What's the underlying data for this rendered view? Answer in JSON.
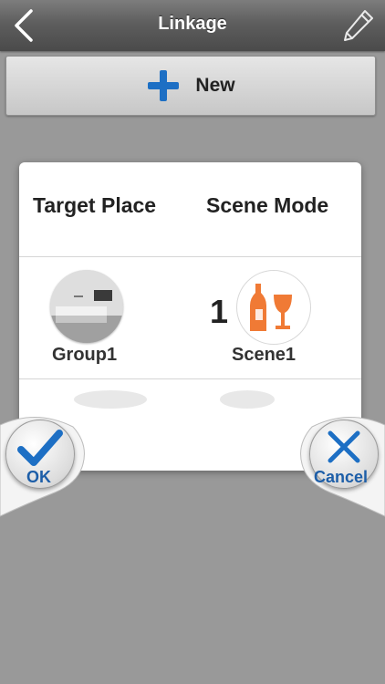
{
  "header": {
    "title": "Linkage"
  },
  "toolbar": {
    "new_label": "New"
  },
  "dialog": {
    "columns": [
      "Target Place",
      "Scene Mode"
    ],
    "rows": [
      {
        "place": "Group1",
        "scene_number": "1",
        "scene": "Scene1"
      }
    ]
  },
  "actions": {
    "ok_label": "OK",
    "cancel_label": "Cancel"
  },
  "colors": {
    "accent_blue": "#1d6fc4",
    "scene_orange": "#f07a35"
  }
}
